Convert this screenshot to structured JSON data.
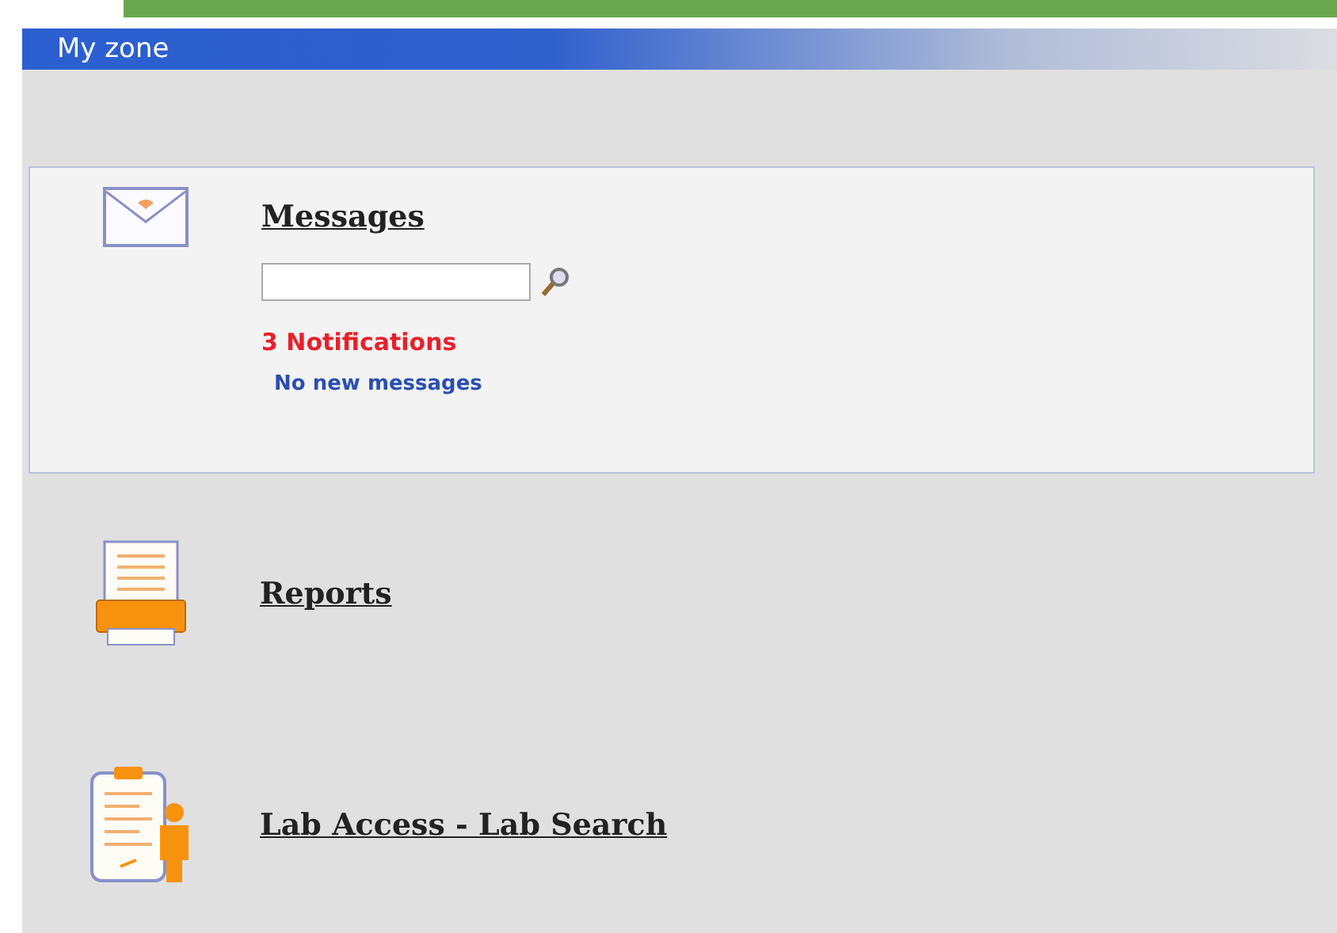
{
  "header": {
    "title": "My zone"
  },
  "sections": [
    {
      "kind": "messages",
      "title": "Messages",
      "notifications": "3 Notifications",
      "status": "No new messages"
    },
    {
      "kind": "reports",
      "title": "Reports"
    },
    {
      "kind": "lab",
      "title": "Lab Access - Lab Search"
    }
  ]
}
